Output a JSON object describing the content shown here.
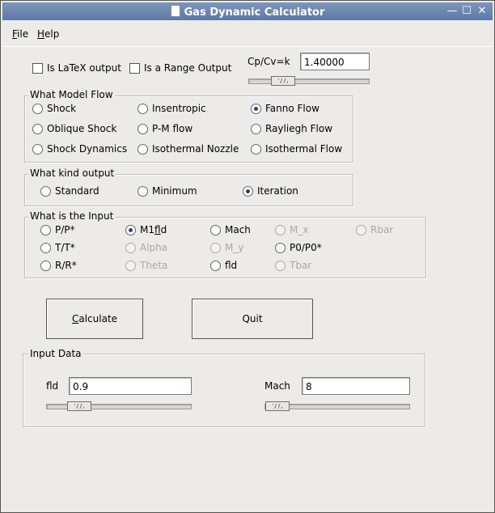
{
  "window": {
    "title": "Gas Dynamic Calculator",
    "controls": {
      "minimize": "—",
      "maximize": "☐",
      "close": "✕"
    }
  },
  "menu": [
    {
      "key": "F",
      "rest": "ile"
    },
    {
      "key": "H",
      "rest": "elp"
    }
  ],
  "options": {
    "latex_label": "Is LaTeX output",
    "range_label": "Is a Range Output",
    "latex_checked": false,
    "range_checked": false
  },
  "cpcv": {
    "label": "Cp/Cv=k",
    "value": "1.40000"
  },
  "model": {
    "title": "What Model Flow",
    "items": [
      "Shock",
      "Insentropic",
      "Fanno Flow",
      "Oblique Shock",
      "P-M flow",
      "Rayliegh Flow",
      "Shock Dynamics",
      "Isothermal Nozzle",
      "Isothermal Flow"
    ],
    "selected": "Fanno Flow"
  },
  "output": {
    "title": "What kind output",
    "items": [
      "Standard",
      "Minimum",
      "Iteration"
    ],
    "selected": "Iteration"
  },
  "input": {
    "title": "What is the Input",
    "items": [
      {
        "label": "P/P*",
        "enabled": true
      },
      {
        "label": "M1fld",
        "enabled": true,
        "selected": true
      },
      {
        "label": "Mach",
        "enabled": true
      },
      {
        "label": "M_x",
        "enabled": false
      },
      {
        "label": "Rbar",
        "enabled": false
      },
      {
        "label": "T/T*",
        "enabled": true
      },
      {
        "label": "Alpha",
        "enabled": false
      },
      {
        "label": "M_y",
        "enabled": false
      },
      {
        "label": "P0/P0*",
        "enabled": true
      },
      {
        "label": "R/R*",
        "enabled": true
      },
      {
        "label": "Theta",
        "enabled": false
      },
      {
        "label": "fld",
        "enabled": true
      },
      {
        "label": "Tbar",
        "enabled": false
      }
    ]
  },
  "buttons": {
    "calculate_key": "C",
    "calculate_rest": "alculate",
    "quit": "Quit"
  },
  "input_data": {
    "title": "Input Data",
    "fld_label": "fld",
    "fld_value": "0.9",
    "mach_label": "Mach",
    "mach_value": "8"
  }
}
